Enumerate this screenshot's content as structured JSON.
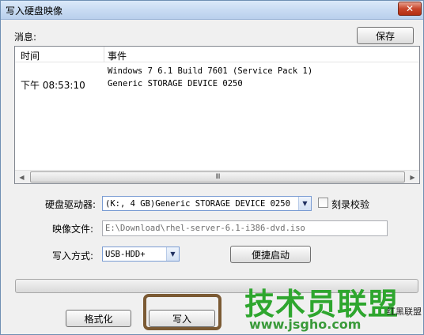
{
  "window": {
    "title": "写入硬盘映像",
    "close_glyph": "✕"
  },
  "messages": {
    "label": "消息:",
    "save_button": "保存",
    "columns": {
      "time": "时间",
      "event": "事件"
    },
    "rows": [
      {
        "time": "",
        "event": "Windows 7 6.1 Build 7601 (Service Pack 1)"
      },
      {
        "time": "下午 08:53:10",
        "event": "Generic STORAGE DEVICE  0250"
      }
    ],
    "scroll_thumb_grip": "III"
  },
  "form": {
    "drive_label": "硬盘驱动器:",
    "drive_value": "(K:, 4 GB)Generic STORAGE DEVICE  0250",
    "verify_label": "刻录校验",
    "verify_checked": false,
    "image_label": "映像文件:",
    "image_value": "E:\\Download\\rhel-server-6.1-i386-dvd.iso",
    "method_label": "写入方式:",
    "method_value": "USB-HDD+",
    "quick_boot_button": "便捷启动"
  },
  "progress": {
    "value": 0
  },
  "footer": {
    "format_button": "格式化",
    "write_button": "写入"
  },
  "watermark": {
    "title": "技术员联盟",
    "url": "www.jsgho.com",
    "small_text": "红黑联盟"
  },
  "colors": {
    "highlight_box": "#7b5a34",
    "watermark_green": "#2ea62e"
  }
}
